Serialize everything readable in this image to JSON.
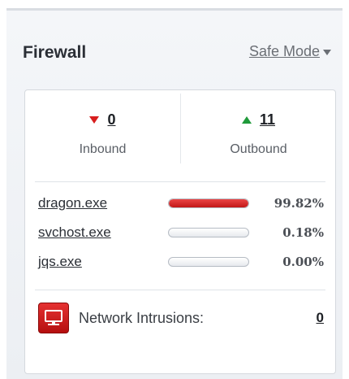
{
  "header": {
    "title": "Firewall",
    "mode_label": "Safe Mode"
  },
  "stats": {
    "inbound": {
      "count": "0",
      "label": "Inbound",
      "color": "#d81e1e"
    },
    "outbound": {
      "count": "11",
      "label": "Outbound",
      "color": "#1f9a3a"
    }
  },
  "processes": [
    {
      "name": "dragon.exe",
      "percent": "99.82%",
      "usage": 0.9982
    },
    {
      "name": "svchost.exe",
      "percent": "0.18%",
      "usage": 0.0018
    },
    {
      "name": "jqs.exe",
      "percent": "0.00%",
      "usage": 0.0
    }
  ],
  "intrusions": {
    "label": "Network Intrusions:",
    "count": "0",
    "icon": "network-computer-icon"
  },
  "colors": {
    "accent_red": "#d81e1e",
    "accent_green": "#1f9a3a"
  }
}
